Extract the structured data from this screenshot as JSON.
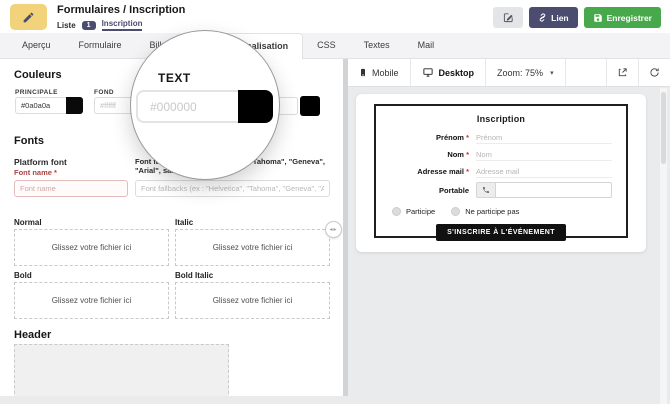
{
  "colors": {
    "accent_navy": "#4c4c70",
    "accent_green": "#48a94c",
    "logo_yellow": "#f2d37b",
    "error_red": "#a94442",
    "principale_swatch": "#0a0a0a",
    "text_swatch": "#000000"
  },
  "header": {
    "title": "Formulaires / Inscription",
    "liste_label": "Liste",
    "liste_badge": "1",
    "current_form": "Inscription",
    "link_button": "Lien",
    "save_button": "Enregistrer"
  },
  "tabs": [
    {
      "label": "Aperçu"
    },
    {
      "label": "Formulaire"
    },
    {
      "label": "Billetterie"
    },
    {
      "label": "Personnalisation",
      "active": true
    },
    {
      "label": "CSS"
    },
    {
      "label": "Textes"
    },
    {
      "label": "Mail"
    }
  ],
  "design_panel": {
    "colors_section": {
      "title": "Couleurs",
      "principale": {
        "label": "PRINCIPALE",
        "value": "#0a0a0a",
        "swatch": "#0a0a0a"
      },
      "fond": {
        "label": "FOND",
        "placeholder": "#ffffff"
      },
      "text": {
        "label": "TEXT",
        "placeholder": "#000000",
        "swatch": "#000000"
      }
    },
    "fonts_section": {
      "title": "Fonts",
      "subtitle": "Platform font",
      "font_name": {
        "label": "Font name",
        "required": "*",
        "placeholder": "Font name"
      },
      "font_fallbacks": {
        "label": "Font fallbacks (ex : \"Helvetica\", \"Tahoma\", \"Geneva\", \"Arial\", sans-serif)",
        "placeholder": "Font fallbacks (ex : \"Helvetica\", \"Tahoma\", \"Geneva\", \"Arial\", sans-serif)"
      },
      "dropzones": [
        {
          "label": "Normal",
          "text": "Glissez votre fichier ici"
        },
        {
          "label": "Italic",
          "text": "Glissez votre fichier ici"
        },
        {
          "label": "Bold",
          "text": "Glissez votre fichier ici"
        },
        {
          "label": "Bold Italic",
          "text": "Glissez votre fichier ici"
        }
      ]
    },
    "header_section": {
      "title": "Header"
    }
  },
  "magnifier": {
    "label": "TEXT",
    "placeholder": "#000000",
    "swatch": "#000000"
  },
  "preview": {
    "toolbar": {
      "mobile": "Mobile",
      "desktop": "Desktop",
      "zoom": "Zoom: 75%"
    },
    "form": {
      "title": "Inscription",
      "fields": [
        {
          "label": "Prénom",
          "required": "*",
          "placeholder": "Prénom"
        },
        {
          "label": "Nom",
          "required": "*",
          "placeholder": "Nom"
        },
        {
          "label": "Adresse mail",
          "required": "*",
          "placeholder": "Adresse mail"
        },
        {
          "label": "Portable",
          "required": "",
          "placeholder": ""
        }
      ],
      "radios": [
        {
          "label": "Participe"
        },
        {
          "label": "Ne participe pas"
        }
      ],
      "submit": "S'INSCRIRE À L'ÉVÉNEMENT"
    }
  }
}
